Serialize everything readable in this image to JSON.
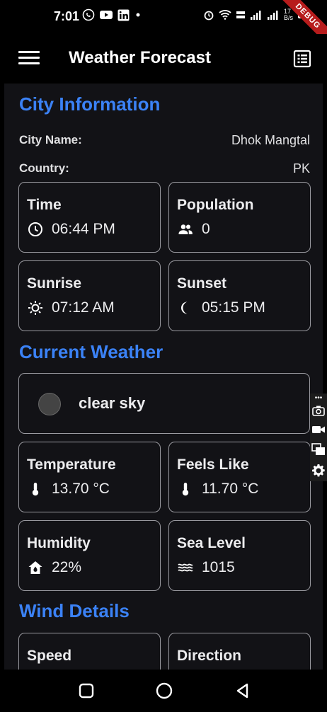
{
  "status_bar": {
    "time": "7:01",
    "network_speed": "17\nB/s",
    "debug_banner": "DEBUG"
  },
  "app_bar": {
    "title": "Weather Forecast"
  },
  "city_information": {
    "heading": "City Information",
    "city_label": "City Name:",
    "city_value": "Dhok Mangtal",
    "country_label": "Country:",
    "country_value": "PK",
    "cards": [
      {
        "title": "Time",
        "value": "06:44 PM",
        "icon": "clock-icon"
      },
      {
        "title": "Population",
        "value": "0",
        "icon": "people-icon"
      },
      {
        "title": "Sunrise",
        "value": "07:12 AM",
        "icon": "sun-icon"
      },
      {
        "title": "Sunset",
        "value": "05:15 PM",
        "icon": "moon-icon"
      }
    ]
  },
  "current_weather": {
    "heading": "Current Weather",
    "description": "clear sky",
    "cards": [
      {
        "title": "Temperature",
        "value": "13.70 °C",
        "icon": "thermometer-icon"
      },
      {
        "title": "Feels Like",
        "value": "11.70 °C",
        "icon": "thermometer-icon"
      },
      {
        "title": "Humidity",
        "value": "22%",
        "icon": "humidity-home-icon"
      },
      {
        "title": "Sea Level",
        "value": "1015",
        "icon": "waves-icon"
      }
    ]
  },
  "wind_details": {
    "heading": "Wind Details",
    "cards": [
      {
        "title": "Speed"
      },
      {
        "title": "Direction"
      }
    ]
  },
  "colors": {
    "accent": "#3b82f6",
    "background": "#121216",
    "card_border": "#9a9aa0",
    "bar": "#000000"
  }
}
